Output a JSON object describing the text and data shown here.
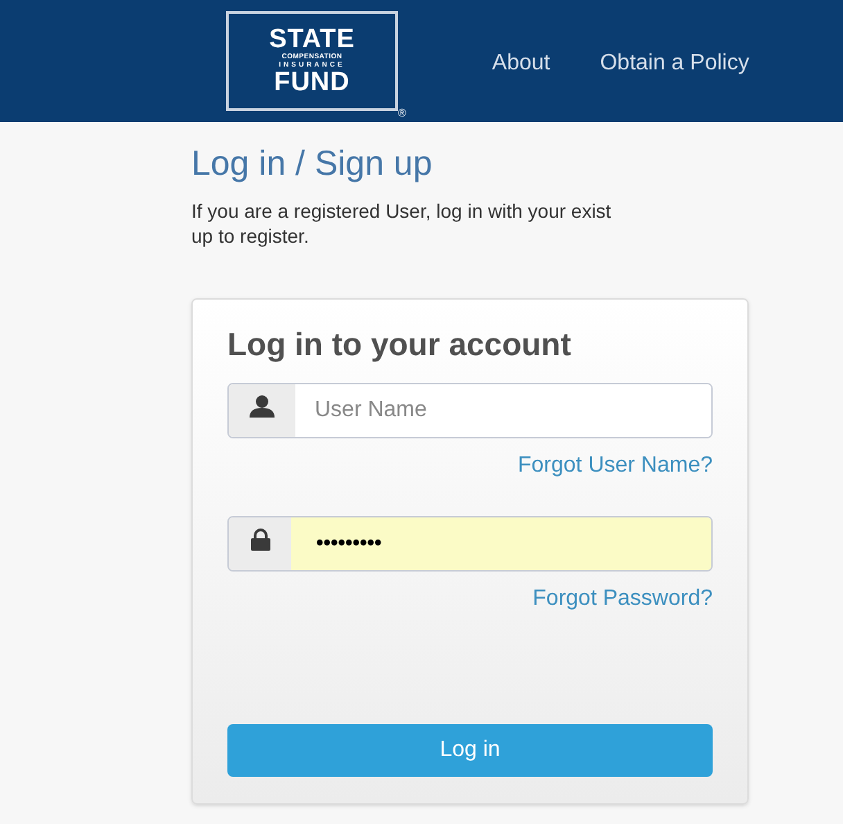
{
  "header": {
    "logo": {
      "top": "STATE",
      "middle_1": "COMPENSATION",
      "middle_2": "INSURANCE",
      "bottom": "FUND",
      "mark": "®"
    },
    "nav": [
      "About",
      "Obtain a Policy"
    ]
  },
  "title": "Log in / Sign up",
  "intro": "If you are a registered User, log in with your exist\nup to register.",
  "login_card": {
    "heading": "Log in to your account",
    "username": {
      "placeholder": "User Name"
    },
    "forgot_username": "Forgot User Name?",
    "password": {
      "value": "•••••••••",
      "autofilled": true
    },
    "forgot_password": "Forgot Password?",
    "button": "Log in"
  }
}
